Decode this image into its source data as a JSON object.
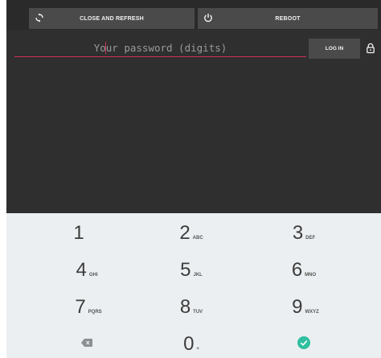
{
  "toolbar": {
    "refresh_label": "CLOSE AND REFRESH",
    "refresh_icon": "refresh-icon",
    "reboot_label": "REBOOT",
    "reboot_icon": "power-icon"
  },
  "login": {
    "password_placeholder": "Your password (digits)",
    "password_value": "",
    "login_label": "LOG IN",
    "lock_icon": "lock-icon"
  },
  "keypad": {
    "keys": [
      {
        "digit": "1",
        "letters": ""
      },
      {
        "digit": "2",
        "letters": "ABC"
      },
      {
        "digit": "3",
        "letters": "DEF"
      },
      {
        "digit": "4",
        "letters": "GHI"
      },
      {
        "digit": "5",
        "letters": "JKL"
      },
      {
        "digit": "6",
        "letters": "MNO"
      },
      {
        "digit": "7",
        "letters": "PQRS"
      },
      {
        "digit": "8",
        "letters": "TUV"
      },
      {
        "digit": "9",
        "letters": "WXYZ"
      },
      {
        "digit": "0",
        "letters": "+"
      }
    ],
    "backspace_icon": "backspace-icon",
    "done_icon": "check-circle-icon"
  },
  "colors": {
    "background": "#2f2f2f",
    "button": "#4a4a4a",
    "accent_underline": "#d0305a",
    "keypad_bg": "#eceff1",
    "done_green": "#2fbf9f"
  }
}
